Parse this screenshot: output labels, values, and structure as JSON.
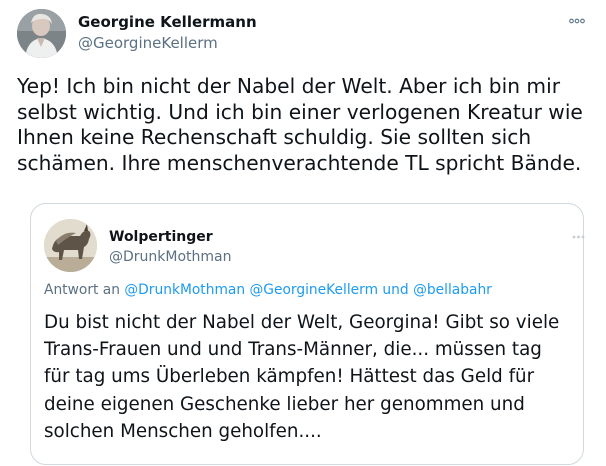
{
  "tweet": {
    "author": {
      "name": "Georgine Kellermann",
      "handle": "@GeorgineKellerm"
    },
    "text": "Yep! Ich bin nicht der Nabel der Welt. Aber ich bin mir selbst wichtig. Und ich bin einer verlogenen Kreatur wie Ihnen keine Rechenschaft schuldig. Sie sollten sich schämen. Ihre menschenverachtende TL spricht Bände.",
    "more_icon": "more-horizontal-icon"
  },
  "quoted": {
    "author": {
      "name": "Wolpertinger",
      "handle": "@DrunkMothman"
    },
    "reply_prefix": "Antwort an",
    "mention_1": "@DrunkMothman",
    "mention_2": "@GeorgineKellerm",
    "reply_conjunction": "und",
    "mention_3": "@bellabahr",
    "text": "Du bist nicht der Nabel der Welt, Georgina! Gibt so viele Trans-Frauen und und Trans-Männer, die... müssen tag für tag ums Überleben kämpfen! Hättest das Geld für deine eigenen Geschenke lieber her genommen und solchen Menschen geholfen....",
    "more_icon": "more-horizontal-icon"
  },
  "colors": {
    "text": "#0f1419",
    "secondary": "#5b7083",
    "link": "#1d9bf0",
    "border": "#cfd9de"
  }
}
